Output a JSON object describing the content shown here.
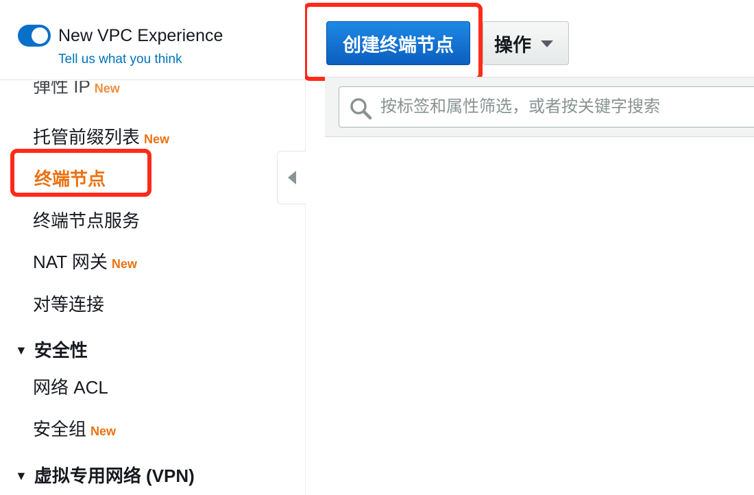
{
  "vpc_experience": {
    "title": "New VPC Experience",
    "feedback_link": "Tell us what you think",
    "toggle_on": true
  },
  "sidebar": {
    "items": [
      {
        "label": "弹性 IP",
        "badge": "New",
        "state": "partially-visible"
      },
      {
        "label": "托管前缀列表",
        "badge": "New"
      },
      {
        "label": "终端节点",
        "badge": "",
        "state": "selected"
      },
      {
        "label": "终端节点服务",
        "badge": ""
      },
      {
        "label": "NAT 网关",
        "badge": "New"
      },
      {
        "label": "对等连接",
        "badge": ""
      }
    ],
    "sections": [
      {
        "label": "安全性",
        "items": [
          {
            "label": "网络 ACL",
            "badge": ""
          },
          {
            "label": "安全组",
            "badge": "New"
          }
        ]
      },
      {
        "label": "虚拟专用网络 (VPN)",
        "items": []
      }
    ]
  },
  "toolbar": {
    "create_button": "创建终端节点",
    "actions_button": "操作"
  },
  "filter": {
    "placeholder": "按标签和属性筛选，或者按关键字搜索"
  },
  "colors": {
    "primary_button": "#0b6fd0",
    "selected_nav": "#ec7211",
    "new_badge": "#ec7211",
    "annotation_box": "#ff2a1a",
    "link": "#0073bb"
  },
  "icons": {
    "toggle": "toggle-switch-icon",
    "collapse": "caret-left-icon",
    "search": "search-icon",
    "dropdown": "chevron-down-icon",
    "section_caret": "caret-down-icon"
  }
}
